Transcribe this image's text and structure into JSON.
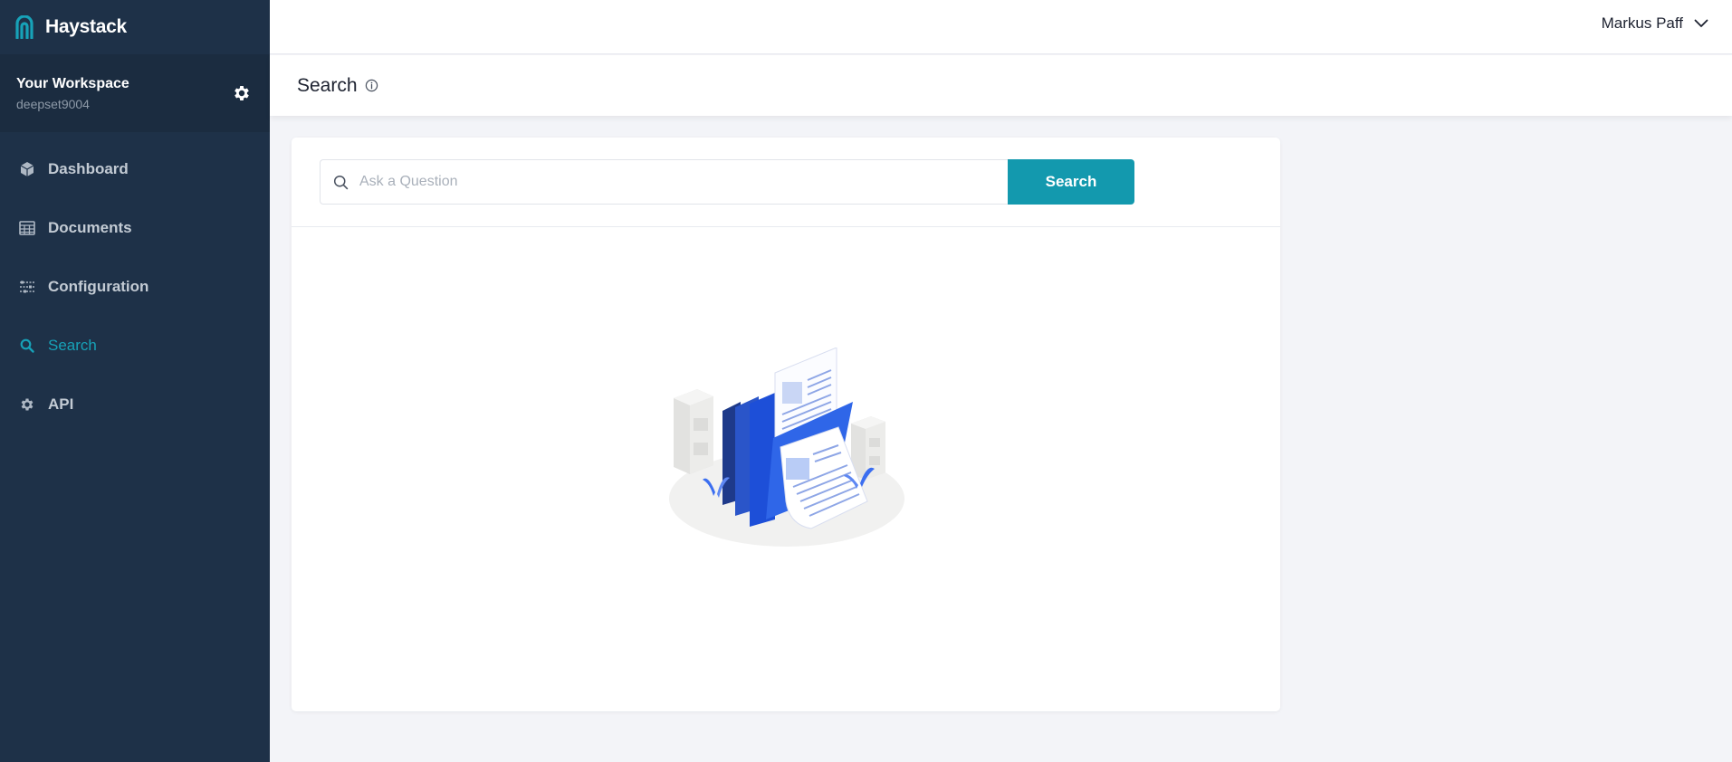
{
  "brand": {
    "name": "Haystack",
    "logo_icon": "haystack-logo-icon"
  },
  "workspace": {
    "title": "Your Workspace",
    "subtitle": "deepset9004",
    "settings_icon": "gear-icon"
  },
  "nav": {
    "items": [
      {
        "label": "Dashboard",
        "icon": "cube-icon",
        "active": false
      },
      {
        "label": "Documents",
        "icon": "table-icon",
        "active": false
      },
      {
        "label": "Configuration",
        "icon": "sliders-icon",
        "active": false
      },
      {
        "label": "Search",
        "icon": "search-icon",
        "active": true
      },
      {
        "label": "API",
        "icon": "gear-icon",
        "active": false
      }
    ]
  },
  "user": {
    "name": "Markus Paff",
    "menu_icon": "chevron-down-icon"
  },
  "page": {
    "title": "Search",
    "info_icon": "info-icon"
  },
  "search": {
    "placeholder": "Ask a Question",
    "value": "",
    "button_label": "Search"
  },
  "empty_state": {
    "illustration": "documents-illustration"
  },
  "colors": {
    "sidebar_bg": "#1e3148",
    "workspace_bg": "#1b2c40",
    "accent": "#1399ae",
    "active_nav": "#17a2b8",
    "page_bg": "#f3f4f8"
  }
}
